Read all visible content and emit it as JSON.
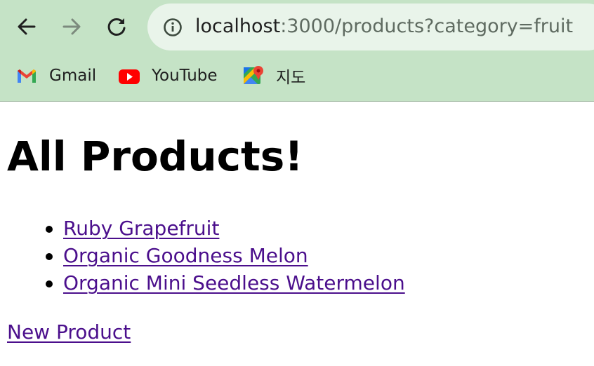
{
  "browser": {
    "url_host": "localhost",
    "url_rest": ":3000/products?category=fruit",
    "bookmarks": [
      {
        "label": "Gmail",
        "icon": "gmail-icon"
      },
      {
        "label": "YouTube",
        "icon": "youtube-icon"
      },
      {
        "label": "지도",
        "icon": "maps-icon"
      }
    ]
  },
  "page": {
    "title": "All Products!",
    "products": [
      "Ruby Grapefruit",
      "Organic Goodness Melon",
      "Organic Mini Seedless Watermelon"
    ],
    "new_product_link": "New Product"
  },
  "colors": {
    "chrome_bg": "#c5e3c6",
    "omnibox_bg": "#e9f4ea",
    "link": "#4b0f8c"
  }
}
